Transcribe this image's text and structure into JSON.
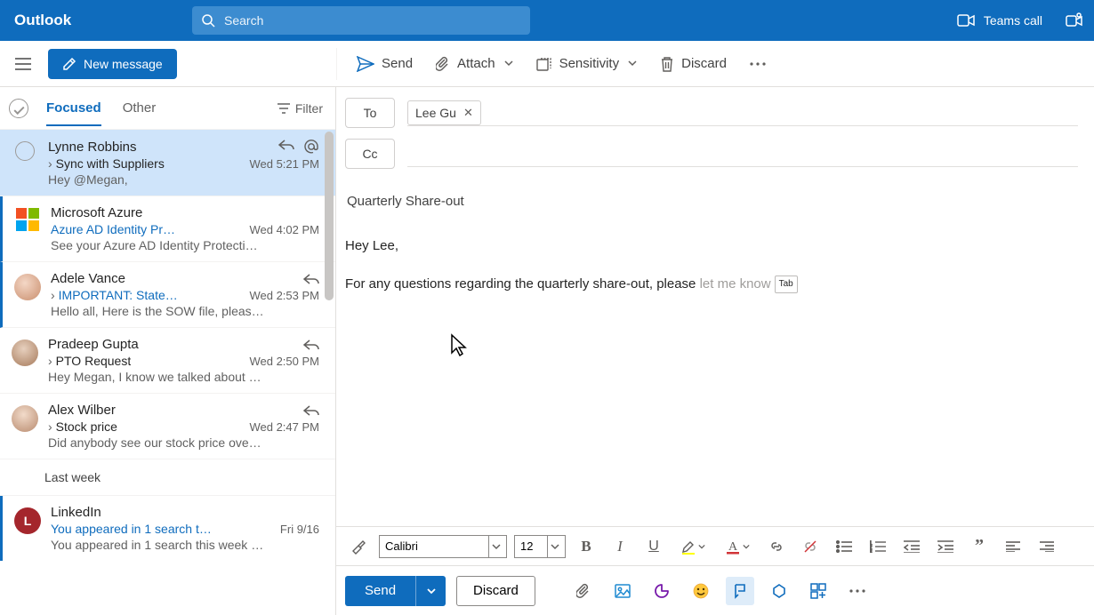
{
  "brand": "Outlook",
  "search": {
    "placeholder": "Search"
  },
  "topbar": {
    "teams_call": "Teams call"
  },
  "commandbar": {
    "new_message": "New message",
    "send": "Send",
    "attach": "Attach",
    "sensitivity": "Sensitivity",
    "discard": "Discard"
  },
  "list": {
    "tab_focused": "Focused",
    "tab_other": "Other",
    "filter": "Filter",
    "items": [
      {
        "sender": "Lynne Robbins",
        "subject": "Sync with Suppliers",
        "time": "Wed 5:21 PM",
        "preview": "Hey @Megan,",
        "selected": true,
        "unread": false,
        "has_subj_arrow": true,
        "avatar_type": "empty"
      },
      {
        "sender": "Microsoft Azure",
        "subject": "Azure AD Identity Pr…",
        "time": "Wed 4:02 PM",
        "preview": "See your Azure AD Identity Protecti…",
        "unread": true,
        "blue": true,
        "avatar_type": "azure"
      },
      {
        "sender": "Adele Vance",
        "subject": "IMPORTANT: State…",
        "time": "Wed 2:53 PM",
        "preview": "Hello all, Here is the SOW file, pleas…",
        "unread": true,
        "blue": true,
        "has_subj_arrow": true,
        "avatar_type": "photo1"
      },
      {
        "sender": "Pradeep Gupta",
        "subject": "PTO Request",
        "time": "Wed 2:50 PM",
        "preview": "Hey Megan, I know we talked about …",
        "unread": false,
        "has_subj_arrow": true,
        "avatar_type": "photo2"
      },
      {
        "sender": "Alex Wilber",
        "subject": "Stock price",
        "time": "Wed 2:47 PM",
        "preview": "Did anybody see our stock price ove…",
        "unread": false,
        "has_subj_arrow": true,
        "avatar_type": "photo3"
      }
    ],
    "group_label": "Last week",
    "later_items": [
      {
        "sender": "LinkedIn",
        "subject": "You appeared in 1 search t…",
        "time": "Fri 9/16",
        "preview": "You appeared in 1 search this week …",
        "unread": true,
        "blue": true,
        "avatar_type": "letter",
        "avatar_letter": "L",
        "avatar_color": "#a4262c"
      }
    ]
  },
  "compose": {
    "to_label": "To",
    "cc_label": "Cc",
    "recipients": [
      {
        "name": "Lee Gu"
      }
    ],
    "subject": "Quarterly Share-out",
    "body_greeting": "Hey Lee,",
    "body_line": "For any questions regarding the quarterly share-out, please ",
    "body_suggestion": "let me know",
    "tab_hint": "Tab"
  },
  "format": {
    "font_name": "Calibri",
    "font_size": "12"
  },
  "actions": {
    "send": "Send",
    "discard": "Discard"
  }
}
